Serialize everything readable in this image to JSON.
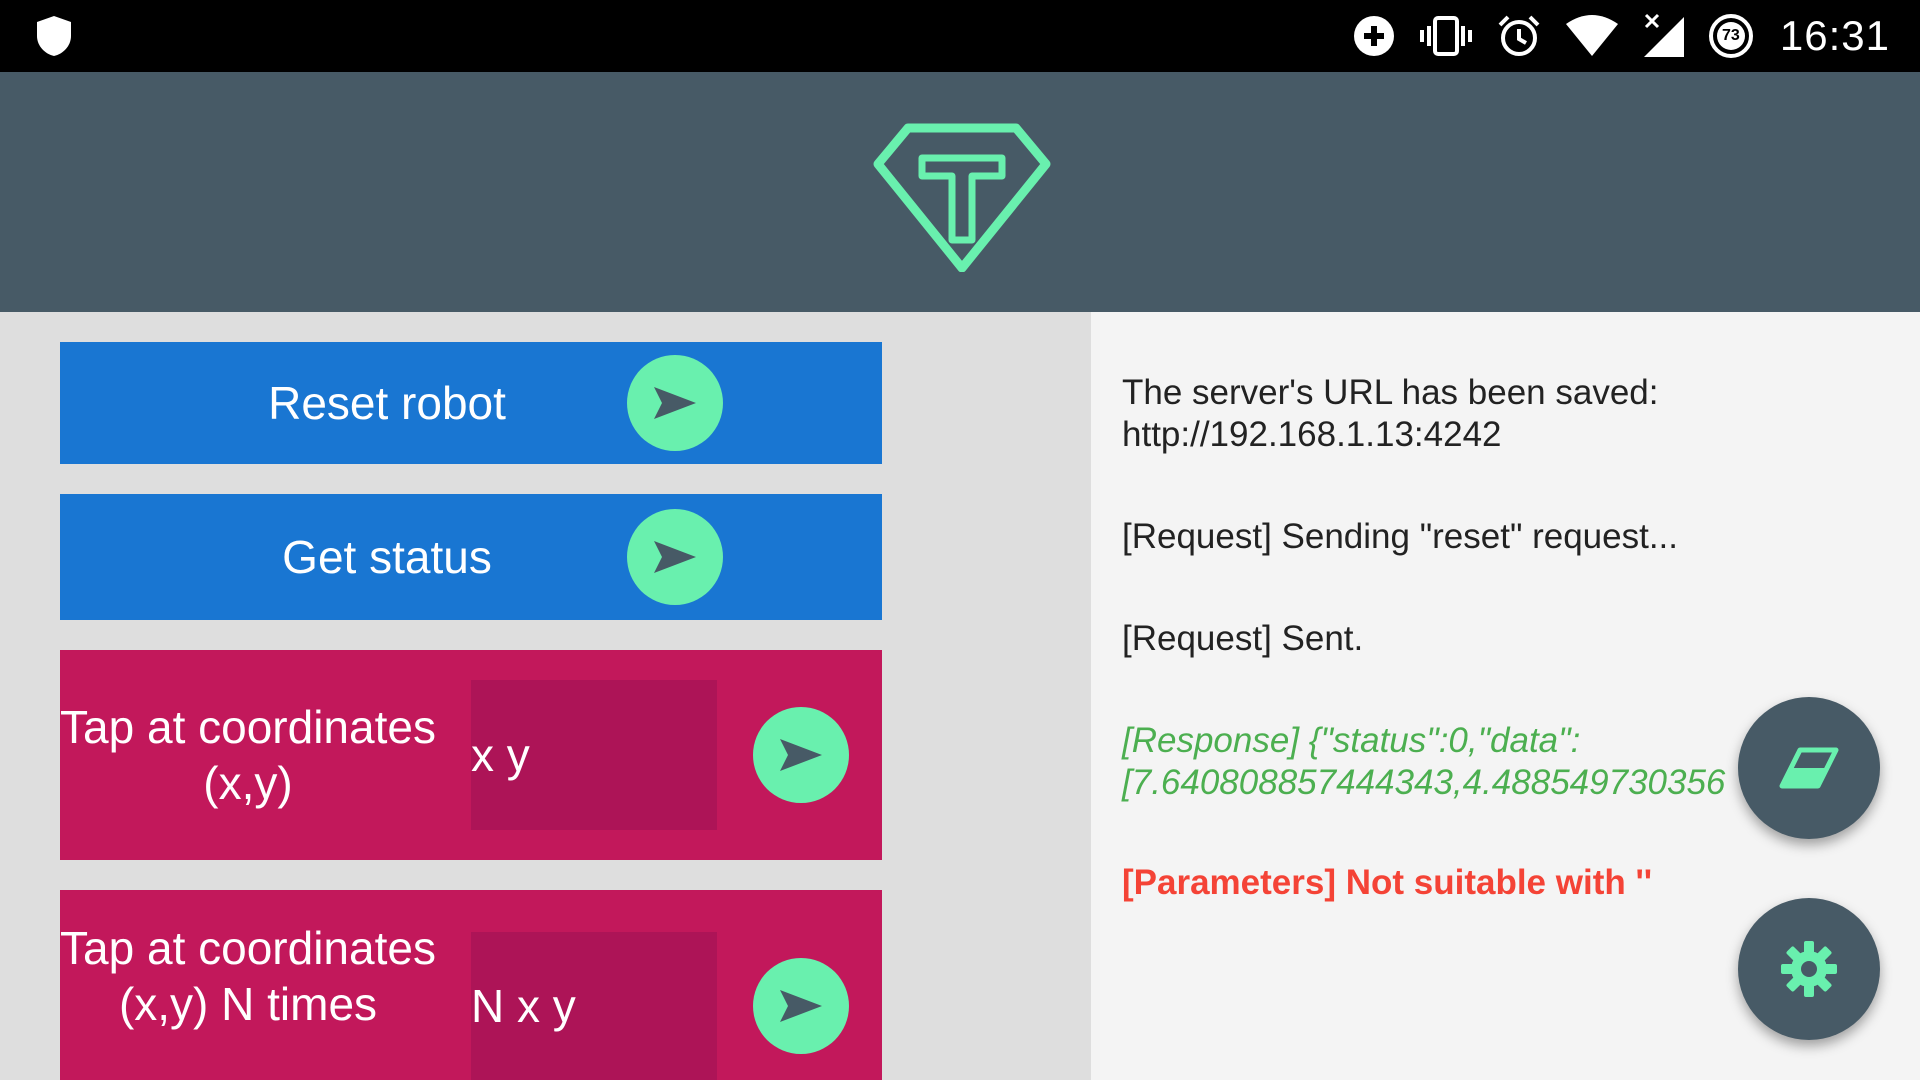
{
  "status_bar": {
    "time": "16:31",
    "battery_level": "73",
    "icons": [
      "shield-icon",
      "add-circle-icon",
      "vibrate-icon",
      "alarm-icon",
      "wifi-icon",
      "signal-icon",
      "battery-icon"
    ]
  },
  "commands": [
    {
      "label": "Reset robot"
    },
    {
      "label": "Get status"
    },
    {
      "label": "Tap at coordinates (x,y)",
      "placeholder": "x y"
    },
    {
      "label": "Tap at coordinates (x,y) N times",
      "placeholder": "N x y"
    }
  ],
  "log": {
    "entries": [
      {
        "text": "The server's URL has been saved:"
      },
      {
        "text": "http://192.168.1.13:4242"
      },
      {
        "text": "[Request] Sending \"reset\" request..."
      },
      {
        "text": "[Request] Sent."
      },
      {
        "text": "[Response] {\"status\":0,\"data\":"
      },
      {
        "text": "[7.640808857444343,4.488549730356"
      },
      {
        "text": "[Parameters] Not suitable with '' "
      }
    ]
  },
  "colors": {
    "header": "#475a66",
    "accent": "#69f0ae",
    "blue_button": "#1976d2",
    "pink_button": "#c2185b",
    "pink_input": "#ad1457",
    "response_text": "#4caf50",
    "error_text": "#f44336"
  },
  "fabs": {
    "clear": "eraser-icon",
    "settings": "gear-icon"
  }
}
